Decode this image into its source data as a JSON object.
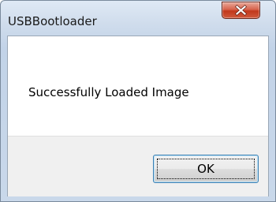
{
  "window": {
    "title": "USBBootloader"
  },
  "titlebar": {
    "close_icon": "close-icon",
    "close_color": "#c7432a"
  },
  "dialog": {
    "message": "Successfully Loaded Image",
    "ok_label": "OK"
  }
}
